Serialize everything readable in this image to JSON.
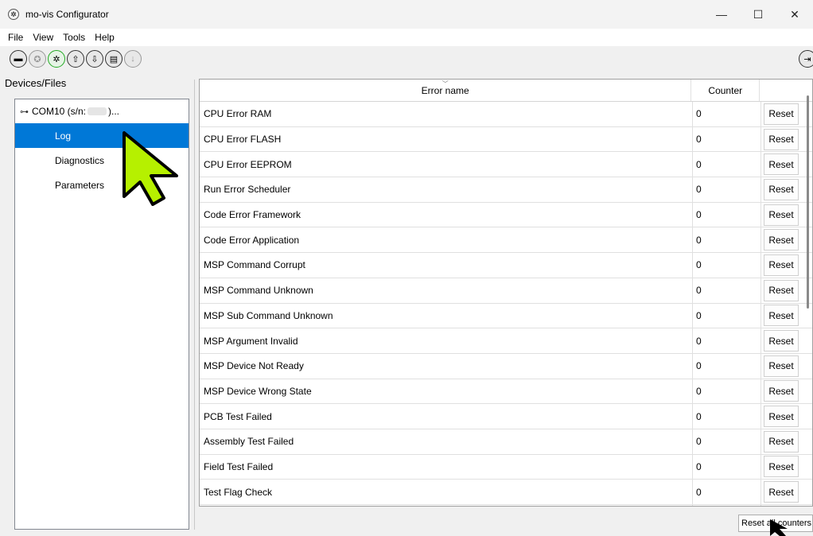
{
  "window": {
    "title": "mo-vis Configurator",
    "minimize": "—",
    "maximize": "☐",
    "close": "✕"
  },
  "menu": {
    "items": [
      "File",
      "View",
      "Tools",
      "Help"
    ]
  },
  "toolbar": {
    "buttons": [
      {
        "icon": "open-folder-icon",
        "glyph": "▬"
      },
      {
        "icon": "device-disabled-icon",
        "glyph": "✪"
      },
      {
        "icon": "connect-device-icon",
        "glyph": "✲"
      },
      {
        "icon": "upload-icon",
        "glyph": "⇧"
      },
      {
        "icon": "download-icon",
        "glyph": "⇩"
      },
      {
        "icon": "document-icon",
        "glyph": "▤"
      },
      {
        "icon": "arrow-down-disabled-icon",
        "glyph": "↓"
      }
    ],
    "exit_glyph": "⇥"
  },
  "left_panel": {
    "title": "Devices/Files",
    "device": {
      "label_prefix": "COM10 (s/n:",
      "label_suffix": ")..."
    },
    "items": [
      "Log",
      "Diagnostics",
      "Parameters"
    ],
    "selected": "Log"
  },
  "table": {
    "columns": {
      "name": "Error name",
      "counter": "Counter"
    },
    "sort_glyph": "﹀",
    "rows": [
      {
        "name": "CPU Error RAM",
        "counter": "0"
      },
      {
        "name": "CPU Error FLASH",
        "counter": "0"
      },
      {
        "name": "CPU Error EEPROM",
        "counter": "0"
      },
      {
        "name": "Run Error Scheduler",
        "counter": "0"
      },
      {
        "name": "Code Error Framework",
        "counter": "0"
      },
      {
        "name": "Code Error Application",
        "counter": "0"
      },
      {
        "name": "MSP Command Corrupt",
        "counter": "0"
      },
      {
        "name": "MSP Command Unknown",
        "counter": "0"
      },
      {
        "name": "MSP Sub Command Unknown",
        "counter": "0"
      },
      {
        "name": "MSP Argument Invalid",
        "counter": "0"
      },
      {
        "name": "MSP Device Not Ready",
        "counter": "0"
      },
      {
        "name": "MSP Device Wrong State",
        "counter": "0"
      },
      {
        "name": "PCB Test Failed",
        "counter": "0"
      },
      {
        "name": "Assembly Test Failed",
        "counter": "0"
      },
      {
        "name": "Field Test Failed",
        "counter": "0"
      },
      {
        "name": "Test Flag Check",
        "counter": "0"
      },
      {
        "name": "",
        "counter": ""
      }
    ],
    "reset_label": "Reset"
  },
  "footer": {
    "reset_all_label": "Reset all counters"
  },
  "colors": {
    "selection": "#0078d7",
    "cursor_fill": "#b6f000"
  }
}
